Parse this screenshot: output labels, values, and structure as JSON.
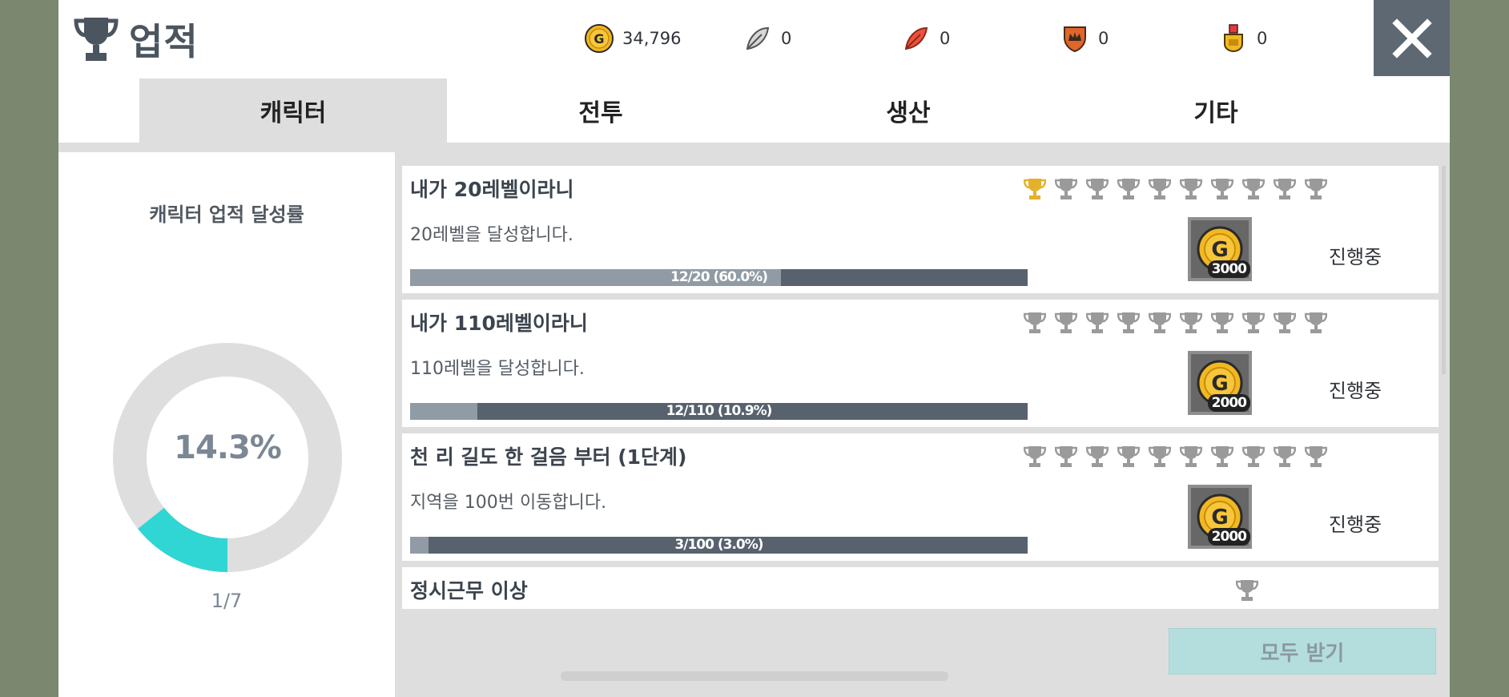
{
  "header": {
    "title": "업적",
    "currencies": [
      {
        "name": "gold",
        "value": "34,796",
        "icon": "gold-coin-icon"
      },
      {
        "name": "silver-feather",
        "value": "0",
        "icon": "silver-feather-icon"
      },
      {
        "name": "red-feather",
        "value": "0",
        "icon": "red-feather-icon"
      },
      {
        "name": "crown-shield",
        "value": "0",
        "icon": "crown-shield-icon"
      },
      {
        "name": "medal",
        "value": "0",
        "icon": "medal-icon"
      }
    ],
    "close_icon": "close-icon"
  },
  "tabs": [
    {
      "label": "캐릭터",
      "active": true
    },
    {
      "label": "전투",
      "active": false
    },
    {
      "label": "생산",
      "active": false
    },
    {
      "label": "기타",
      "active": false
    }
  ],
  "summary": {
    "title": "캐릭터 업적 달성률",
    "percent_text": "14.3%",
    "percent": 14.3,
    "count": "1/7"
  },
  "achievements": [
    {
      "name": "내가 20레벨이라니",
      "desc": "20레벨을 달성합니다.",
      "progress_text": "12/20 (60.0%)",
      "progress": 0.6,
      "trophies_total": 10,
      "trophies_earned": 1,
      "reward": "3000",
      "status": "진행중"
    },
    {
      "name": "내가 110레벨이라니",
      "desc": "110레벨을 달성합니다.",
      "progress_text": "12/110 (10.9%)",
      "progress": 0.109,
      "trophies_total": 10,
      "trophies_earned": 0,
      "reward": "2000",
      "status": "진행중"
    },
    {
      "name": "천 리 길도 한 걸음 부터 (1단계)",
      "desc": "지역을 100번 이동합니다.",
      "progress_text": "3/100 (3.0%)",
      "progress": 0.03,
      "trophies_total": 10,
      "trophies_earned": 0,
      "reward": "2000",
      "status": "진행중"
    },
    {
      "name": "정시근무 이상",
      "trophies_total": 1,
      "trophies_earned": 0
    }
  ],
  "claim_all": "모두 받기",
  "colors": {
    "accent": "#2fd6d4",
    "trophy_gold": "#e3b12c",
    "trophy_gray": "#9a9a9a",
    "bar_bg": "#57626e",
    "bar_fill": "#909ba5"
  }
}
